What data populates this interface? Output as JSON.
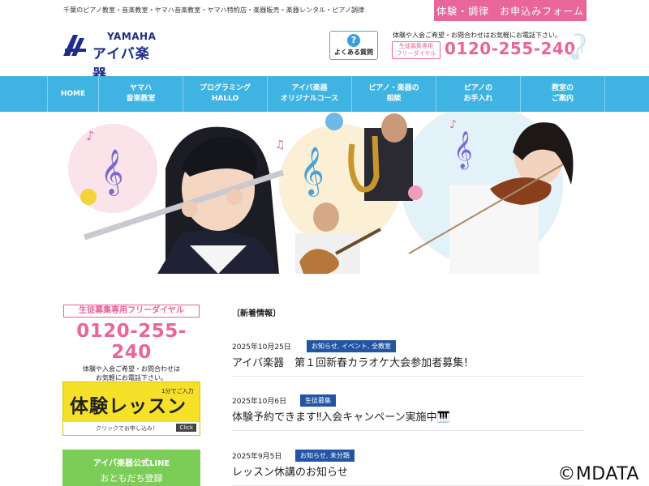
{
  "header": {
    "tagline": "千葉のピアノ教室・音楽教室・ヤマハ音楽教室・ヤマハ特約店・楽器販売・楽器レンタル・ピアノ調律",
    "cta_button": "体験・調律　お申込みフォーム",
    "logo": {
      "brand": "YAMAHA",
      "name": "アイバ楽器"
    },
    "faq": {
      "icon": "question-icon",
      "label": "よくある質問"
    },
    "contact_note": "体験や入会ご希望・お問合わせはお気軽にお電話下さい。",
    "free_dial_badge": [
      "生徒募集専用",
      "フリーダイヤル"
    ],
    "phone": "0120-255-240"
  },
  "nav": {
    "items": [
      {
        "lines": [
          "HOME"
        ]
      },
      {
        "lines": [
          "ヤマハ",
          "音楽教室"
        ]
      },
      {
        "lines": [
          "プログラミング",
          "HALLO"
        ]
      },
      {
        "lines": [
          "アイバ楽器",
          "オリジナルコース"
        ]
      },
      {
        "lines": [
          "ピアノ・楽器の",
          "相談"
        ]
      },
      {
        "lines": [
          "ピアノの",
          "お手入れ"
        ]
      },
      {
        "lines": [
          "教室の",
          "ご案内"
        ]
      }
    ]
  },
  "sidebar": {
    "phone_title": "生徒募集専用フリーダイヤル",
    "phone_number": "0120-255-240",
    "phone_note_1": "体験や入会ご希望・お問合わせは",
    "phone_note_2": "お気軽にお電話下さい。",
    "trial": {
      "title": "体験レッスン",
      "hint": "1分でご入力",
      "foot": "クリックでお申し込み！",
      "click": "Click"
    },
    "line": {
      "title": "アイバ楽器公式LINE",
      "sub": "おともだち登録"
    }
  },
  "news": {
    "heading": "〔新着情報〕",
    "items": [
      {
        "date": "2025年10月25日",
        "category": "お知らせ, イベント, 全教室",
        "title": "アイバ楽器　第１回新春カラオケ大会参加者募集！"
      },
      {
        "date": "2025年10月6日",
        "category": "生徒募集",
        "title": "体験予約できます‼入会キャンペーン実施中🎹"
      },
      {
        "date": "2025年9月5日",
        "category": "お知らせ, 未分類",
        "title": "レッスン休講のお知らせ"
      }
    ]
  },
  "watermark": "©MDATA",
  "colors": {
    "accent_pink": "#e8669a",
    "nav_blue": "#3fb3e2",
    "navy": "#1d2d8c",
    "category_blue": "#2255a4",
    "line_green": "#7ccd58",
    "trial_yellow": "#f5e02a"
  }
}
